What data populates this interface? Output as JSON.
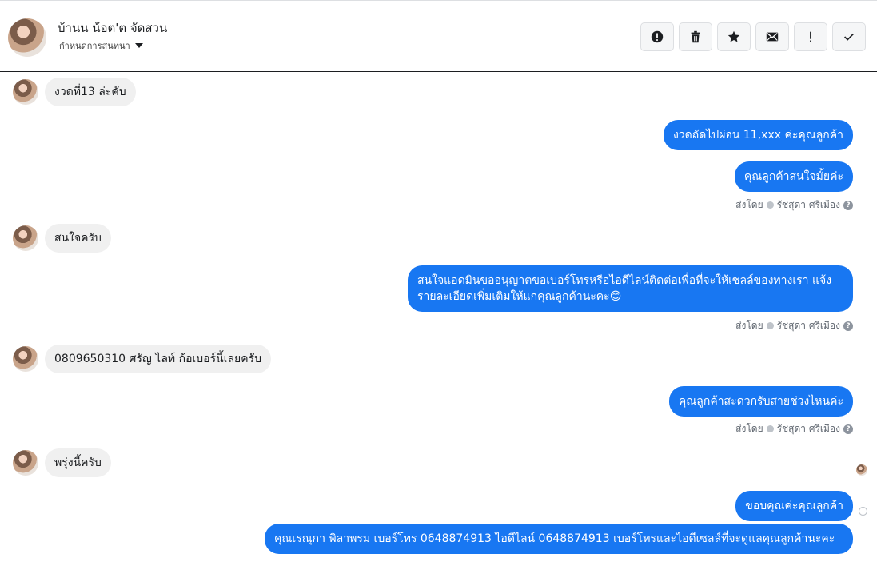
{
  "header": {
    "name": "บ้านน น้อต'ต จัดสวน",
    "subtitle": "กำหนดการสนทนา",
    "actions": [
      {
        "icon": "alert-circle-icon"
      },
      {
        "icon": "trash-icon"
      },
      {
        "icon": "star-icon"
      },
      {
        "icon": "envelope-icon"
      },
      {
        "icon": "exclamation-icon"
      },
      {
        "icon": "check-icon"
      }
    ]
  },
  "messages": {
    "m1": "งวดที่13 ล่ะคับ",
    "m2": "งวดถัดไปผ่อน 11,xxx ค่ะคุณลูกค้า",
    "m3": "คุณลูกค้าสนใจมั้ยค่ะ",
    "sent_label": "ส่งโดย",
    "sender": "รัชสุดา ศรีเมือง",
    "m4": "สนใจครับ",
    "m5": "สนใจแอดมินขออนุญาตขอเบอร์โทรหรือไอดีไลน์ติดต่อเพื่อที่จะให้เซลล์ของทางเรา แจ้งรายละเอียดเพิ่มเติมให้แก่คุณลูกค้านะคะ😊",
    "m6": "0809650310 ศรัญ ไลท์ ก้อเบอร์นี้เลยครับ",
    "m7": "คุณลูกค้าสะดวกรับสายช่วงไหนค่ะ",
    "m8": "พรุ่งนี้ครับ",
    "m9": "ขอบคุณค่ะคุณลูกค้า",
    "m10": "คุณเรณุกา พิลาพรม       เบอร์โทร 0648874913  ไอดีไลน์ 0648874913   เบอร์โทรและไอดีเซลล์ที่จะดูแลคุณลูกค้านะคะ"
  },
  "colors": {
    "outgoing": "#1877f2",
    "incoming": "#f0f0f0"
  }
}
